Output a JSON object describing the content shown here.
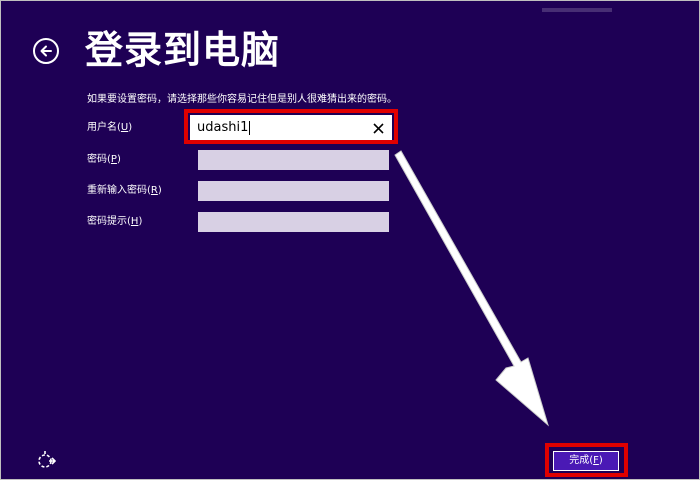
{
  "page": {
    "title": "登录到电脑",
    "instruction": "如果要设置密码，请选择那些你容易记住但是别人很难猜出来的密码。"
  },
  "fields": {
    "username": {
      "label": "用户名(",
      "key": "U",
      "suffix": ")",
      "value": "udashi1"
    },
    "password": {
      "label": "密码(",
      "key": "P",
      "suffix": ")",
      "value": ""
    },
    "confirm": {
      "label": "重新输入密码(",
      "key": "R",
      "suffix": ")",
      "value": ""
    },
    "hint": {
      "label": "密码提示(",
      "key": "H",
      "suffix": ")",
      "value": ""
    }
  },
  "buttons": {
    "finish": {
      "label": "完成(",
      "key": "F",
      "suffix": ")"
    }
  },
  "icons": {
    "back": "back-arrow-icon",
    "clear": "close-icon",
    "accessibility": "ease-of-access-icon"
  },
  "colors": {
    "background": "#1e0055",
    "input_inactive": "#d8d0e4",
    "button": "#4a19b5",
    "highlight": "#e00000"
  }
}
